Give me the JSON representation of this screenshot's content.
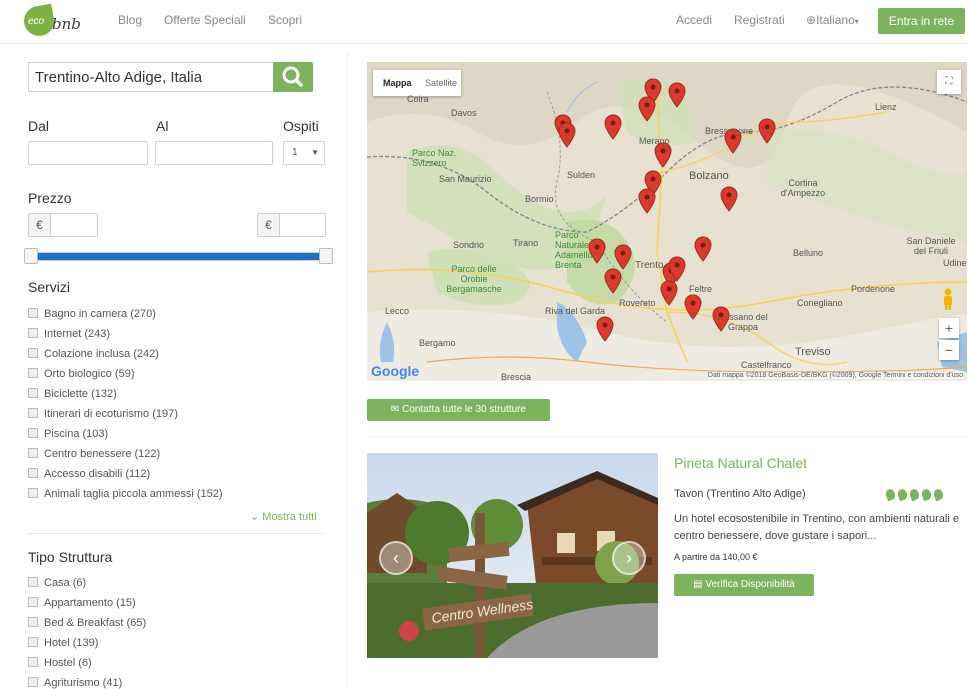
{
  "header": {
    "logo_leaf": "eco",
    "logo_word": "bnb",
    "nav": [
      "Blog",
      "Offerte Speciali",
      "Scopri"
    ],
    "login": "Accedi",
    "register": "Registrati",
    "language": "Italiano",
    "enter_button": "Entra in rete"
  },
  "search": {
    "value": "Trentino-Alto Adige, Italia"
  },
  "dates": {
    "from_label": "Dal",
    "to_label": "Al",
    "guests_label": "Ospiti",
    "guests_value": "1"
  },
  "price": {
    "label": "Prezzo",
    "currency": "€",
    "range": [
      0,
      1
    ]
  },
  "services": {
    "title": "Servizi",
    "items": [
      "Bagno in camera (270)",
      "Internet (243)",
      "Colazione inclusa (242)",
      "Orto biologico (59)",
      "Biciclette (132)",
      "Itinerari di ecoturismo (197)",
      "Piscina (103)",
      "Centro benessere (122)",
      "Accesso disabili (112)",
      "Animali taglia piccola ammessi (152)"
    ],
    "show_all": "Mostra tutti"
  },
  "structure": {
    "title": "Tipo Struttura",
    "items": [
      "Casa (6)",
      "Appartamento (15)",
      "Bed & Breakfast (65)",
      "Hotel (139)",
      "Hostel (6)",
      "Agriturismo (41)"
    ]
  },
  "map": {
    "tab_map": "Mappa",
    "tab_satellite": "Satellite",
    "google": "Google",
    "footer": "Dati mappa ©2018 GeoBasis-DE/BKG (©2009), Google   Termini e condizioni d'uso",
    "places": [
      "Davos",
      "Coira",
      "Parco Naz. Svizzero",
      "San Maurizio",
      "Sulden",
      "Bormio",
      "Merano",
      "Bolzano",
      "Bressanone",
      "Cortina d'Ampezzo",
      "Lienz",
      "Sondrio",
      "Tirano",
      "Parco Naturale Adamello Brenta",
      "Parco delle Orobie Bergamasche",
      "Trento",
      "Lecco",
      "Riva del Garda",
      "Rovereto",
      "Bergamo",
      "Brescia",
      "Bassano del Grappa",
      "Belluno",
      "Feltre",
      "Pordenone",
      "Conegliano",
      "Treviso",
      "Udine",
      "San Daniele del Friuli",
      "Castelfranco"
    ]
  },
  "contact_button": "Contatta tutte le 30 strutture",
  "listing": {
    "title": "Pineta Natural Chalet",
    "location": "Tavon (Trentino Alto Adige)",
    "rating": 5,
    "description": "Un hotel ecosostenibile in Trentino, con ambienti naturali e centro benessere, dove gustare i sapori...",
    "price": "A partire da 140,00 €",
    "verify_button": "Verifica Disponibilità",
    "sign_text": "Centro Wellness"
  },
  "colors": {
    "accent_green": "#7cb35e",
    "slider_blue": "#1a73c8",
    "pin_red": "#d93a2b"
  }
}
